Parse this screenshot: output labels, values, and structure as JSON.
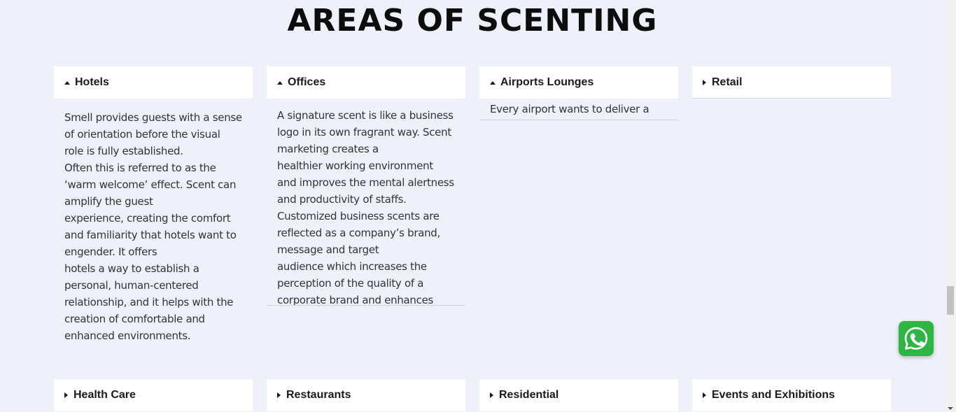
{
  "section": {
    "title": "AREAS OF SCENTING"
  },
  "panels": [
    {
      "title": "Hotels",
      "expanded": true,
      "paragraphs": [
        "Smell provides guests with a sense of orientation before the visual role is fully established.",
        "Often this is referred to as the ‘warm welcome’ effect. Scent can amplify the guest",
        "experience, creating the comfort and familiarity that hotels want to engender. It offers",
        "hotels a way to establish a personal, human-centered relationship, and it helps with the",
        "creation of comfortable and enhanced environments."
      ]
    },
    {
      "title": "Offices",
      "expanded": true,
      "paragraphs": [
        "A signature scent is like a business logo in its own fragrant way. Scent marketing creates a",
        "healthier working environment and improves the mental alertness and productivity of staffs.",
        "Customized business scents are reflected as a company’s brand, message and target",
        "audience which increases the perception of the quality of a corporate brand and enhances"
      ]
    },
    {
      "title": "Airports Lounges",
      "expanded": true,
      "paragraphs": [
        "Every airport wants to deliver a"
      ]
    },
    {
      "title": "Retail",
      "expanded": false
    },
    {
      "title": "Health Care",
      "expanded": false
    },
    {
      "title": "Restaurants",
      "expanded": false
    },
    {
      "title": "Residential",
      "expanded": false
    },
    {
      "title": "Events and Exhibitions",
      "expanded": false
    }
  ],
  "icons": {
    "expanded": "triangle-up-icon",
    "collapsed": "triangle-right-icon",
    "chat": "whatsapp-icon"
  },
  "colors": {
    "background": "#eef1fa",
    "panel_header": "#ffffff",
    "whatsapp": "#2fb543"
  }
}
